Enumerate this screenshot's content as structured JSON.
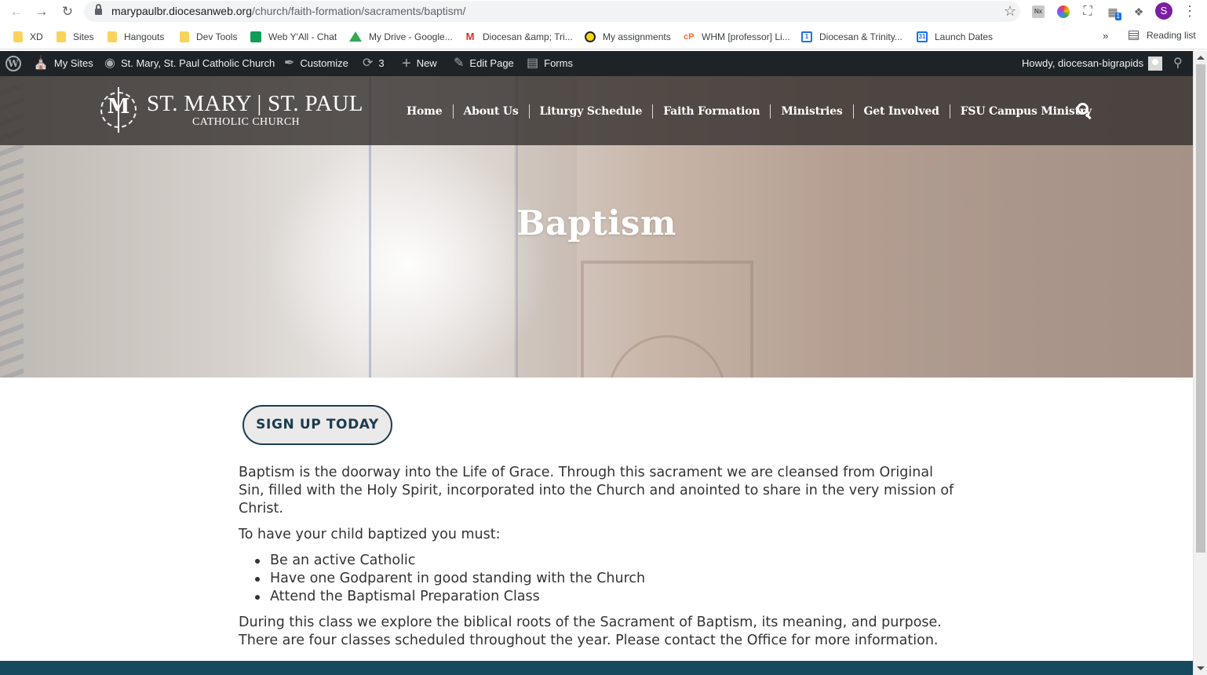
{
  "browser": {
    "url_domain": "marypaulbr.diocesanweb.org",
    "url_path": "/church/faith-formation/sacraments/baptism/",
    "extension_badge": "1",
    "profile_initial": "S"
  },
  "bookmarks": {
    "items": [
      {
        "label": "XD",
        "icon": "folder-icon"
      },
      {
        "label": "Sites",
        "icon": "folder-icon"
      },
      {
        "label": "Hangouts",
        "icon": "folder-icon"
      },
      {
        "label": "Dev Tools",
        "icon": "folder-icon"
      },
      {
        "label": "Web Y'All - Chat",
        "icon": "chat-icon"
      },
      {
        "label": "My Drive - Google...",
        "icon": "drive-icon"
      },
      {
        "label": "Diocesan &amp; Tri...",
        "icon": "gmail-icon"
      },
      {
        "label": "My assignments",
        "icon": "assignments-icon"
      },
      {
        "label": "WHM [professor] Li...",
        "icon": "cpanel-icon"
      },
      {
        "label": "Diocesan & Trinity...",
        "icon": "calendar-icon"
      },
      {
        "label": "Launch Dates",
        "icon": "calendar-icon"
      }
    ],
    "overflow": "»",
    "reading_list": "Reading list"
  },
  "admin_bar": {
    "my_sites": "My Sites",
    "site_name": "St. Mary, St. Paul Catholic Church",
    "customize": "Customize",
    "updates_count": "3",
    "new": "New",
    "edit_page": "Edit Page",
    "forms": "Forms",
    "howdy": "Howdy, diocesan-bigrapids"
  },
  "site": {
    "logo_name": "ST. MARY | ST. PAUL",
    "logo_sub": "CATHOLIC CHURCH",
    "logo_mark": "M",
    "nav": [
      "Home",
      "About Us",
      "Liturgy Schedule",
      "Faith Formation",
      "Ministries",
      "Get Involved",
      "FSU Campus Ministry"
    ],
    "hero_title": "Baptism"
  },
  "content": {
    "button": "SIGN UP TODAY",
    "paragraph1": "Baptism is the doorway into the Life of Grace. Through this sacrament we are cleansed from Original Sin, filled with the Holy Spirit, incorporated into the Church and anointed to share in the very mission of Christ.",
    "paragraph2": "To have your child baptized you must:",
    "requirements": [
      "Be an active Catholic",
      "Have one Godparent in good standing with the Church",
      "Attend the Baptismal Preparation Class"
    ],
    "paragraph3": "During this class we explore the biblical roots of the Sacrament of Baptism, its meaning, and purpose. There are four classes scheduled throughout the year. Please contact the Office for more information."
  },
  "colors": {
    "admin_bar": "#1d2327",
    "button_border": "#1b3b4f",
    "footer_band": "#174a5f"
  }
}
